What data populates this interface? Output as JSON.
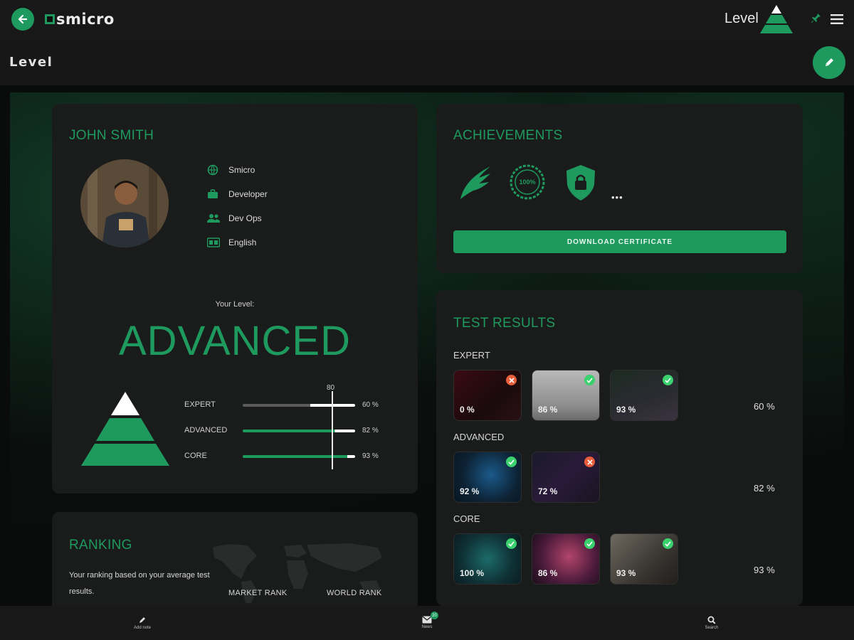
{
  "app": {
    "name": "smicro"
  },
  "header": {
    "level_label": "Level"
  },
  "page": {
    "title": "Level"
  },
  "profile": {
    "name": "JOHN SMITH",
    "info": [
      {
        "icon": "globe-icon",
        "text": "Smicro"
      },
      {
        "icon": "briefcase-icon",
        "text": "Developer"
      },
      {
        "icon": "users-icon",
        "text": "Dev Ops"
      },
      {
        "icon": "language-icon",
        "text": "English"
      }
    ],
    "your_level_label": "Your Level:",
    "level": "ADVANCED",
    "marker_value": "80",
    "bars": [
      {
        "label": "EXPERT",
        "value": 60,
        "pct_text": "60 %"
      },
      {
        "label": "ADVANCED",
        "value": 82,
        "pct_text": "82 %"
      },
      {
        "label": "CORE",
        "value": 93,
        "pct_text": "93 %"
      }
    ]
  },
  "achievements": {
    "title": "ACHIEVEMENTS",
    "badges": [
      "wing-icon",
      "100-percent-badge-icon",
      "lock-shield-icon"
    ],
    "badge_text": "100%",
    "more": "•••",
    "download_label": "DOWNLOAD CERTIFICATE"
  },
  "test_results": {
    "title": "TEST RESULTS",
    "sections": [
      {
        "label": "EXPERT",
        "total": "60 %",
        "tests": [
          {
            "pct": "0 %",
            "status": "fail"
          },
          {
            "pct": "86 %",
            "status": "pass"
          },
          {
            "pct": "93 %",
            "status": "pass"
          }
        ]
      },
      {
        "label": "ADVANCED",
        "total": "82 %",
        "tests": [
          {
            "pct": "92 %",
            "status": "pass"
          },
          {
            "pct": "72 %",
            "status": "fail"
          }
        ]
      },
      {
        "label": "CORE",
        "total": "93 %",
        "tests": [
          {
            "pct": "100 %",
            "status": "pass"
          },
          {
            "pct": "86 %",
            "status": "pass"
          },
          {
            "pct": "93 %",
            "status": "pass"
          }
        ]
      }
    ]
  },
  "ranking": {
    "title": "RANKING",
    "description": "Your ranking based on your average test results.",
    "market_rank": "MARKET RANK",
    "world_rank": "WORLD RANK"
  },
  "bottom_nav": {
    "items": [
      {
        "icon": "note-icon",
        "label": "Add note"
      },
      {
        "icon": "mail-icon",
        "label": "News",
        "badge": "20"
      },
      {
        "icon": "search-icon",
        "label": "Search"
      }
    ]
  },
  "colors": {
    "accent": "#1f9a5f",
    "card": "#1a1b1b",
    "fail": "#e85d3a",
    "pass": "#3bd16f"
  }
}
